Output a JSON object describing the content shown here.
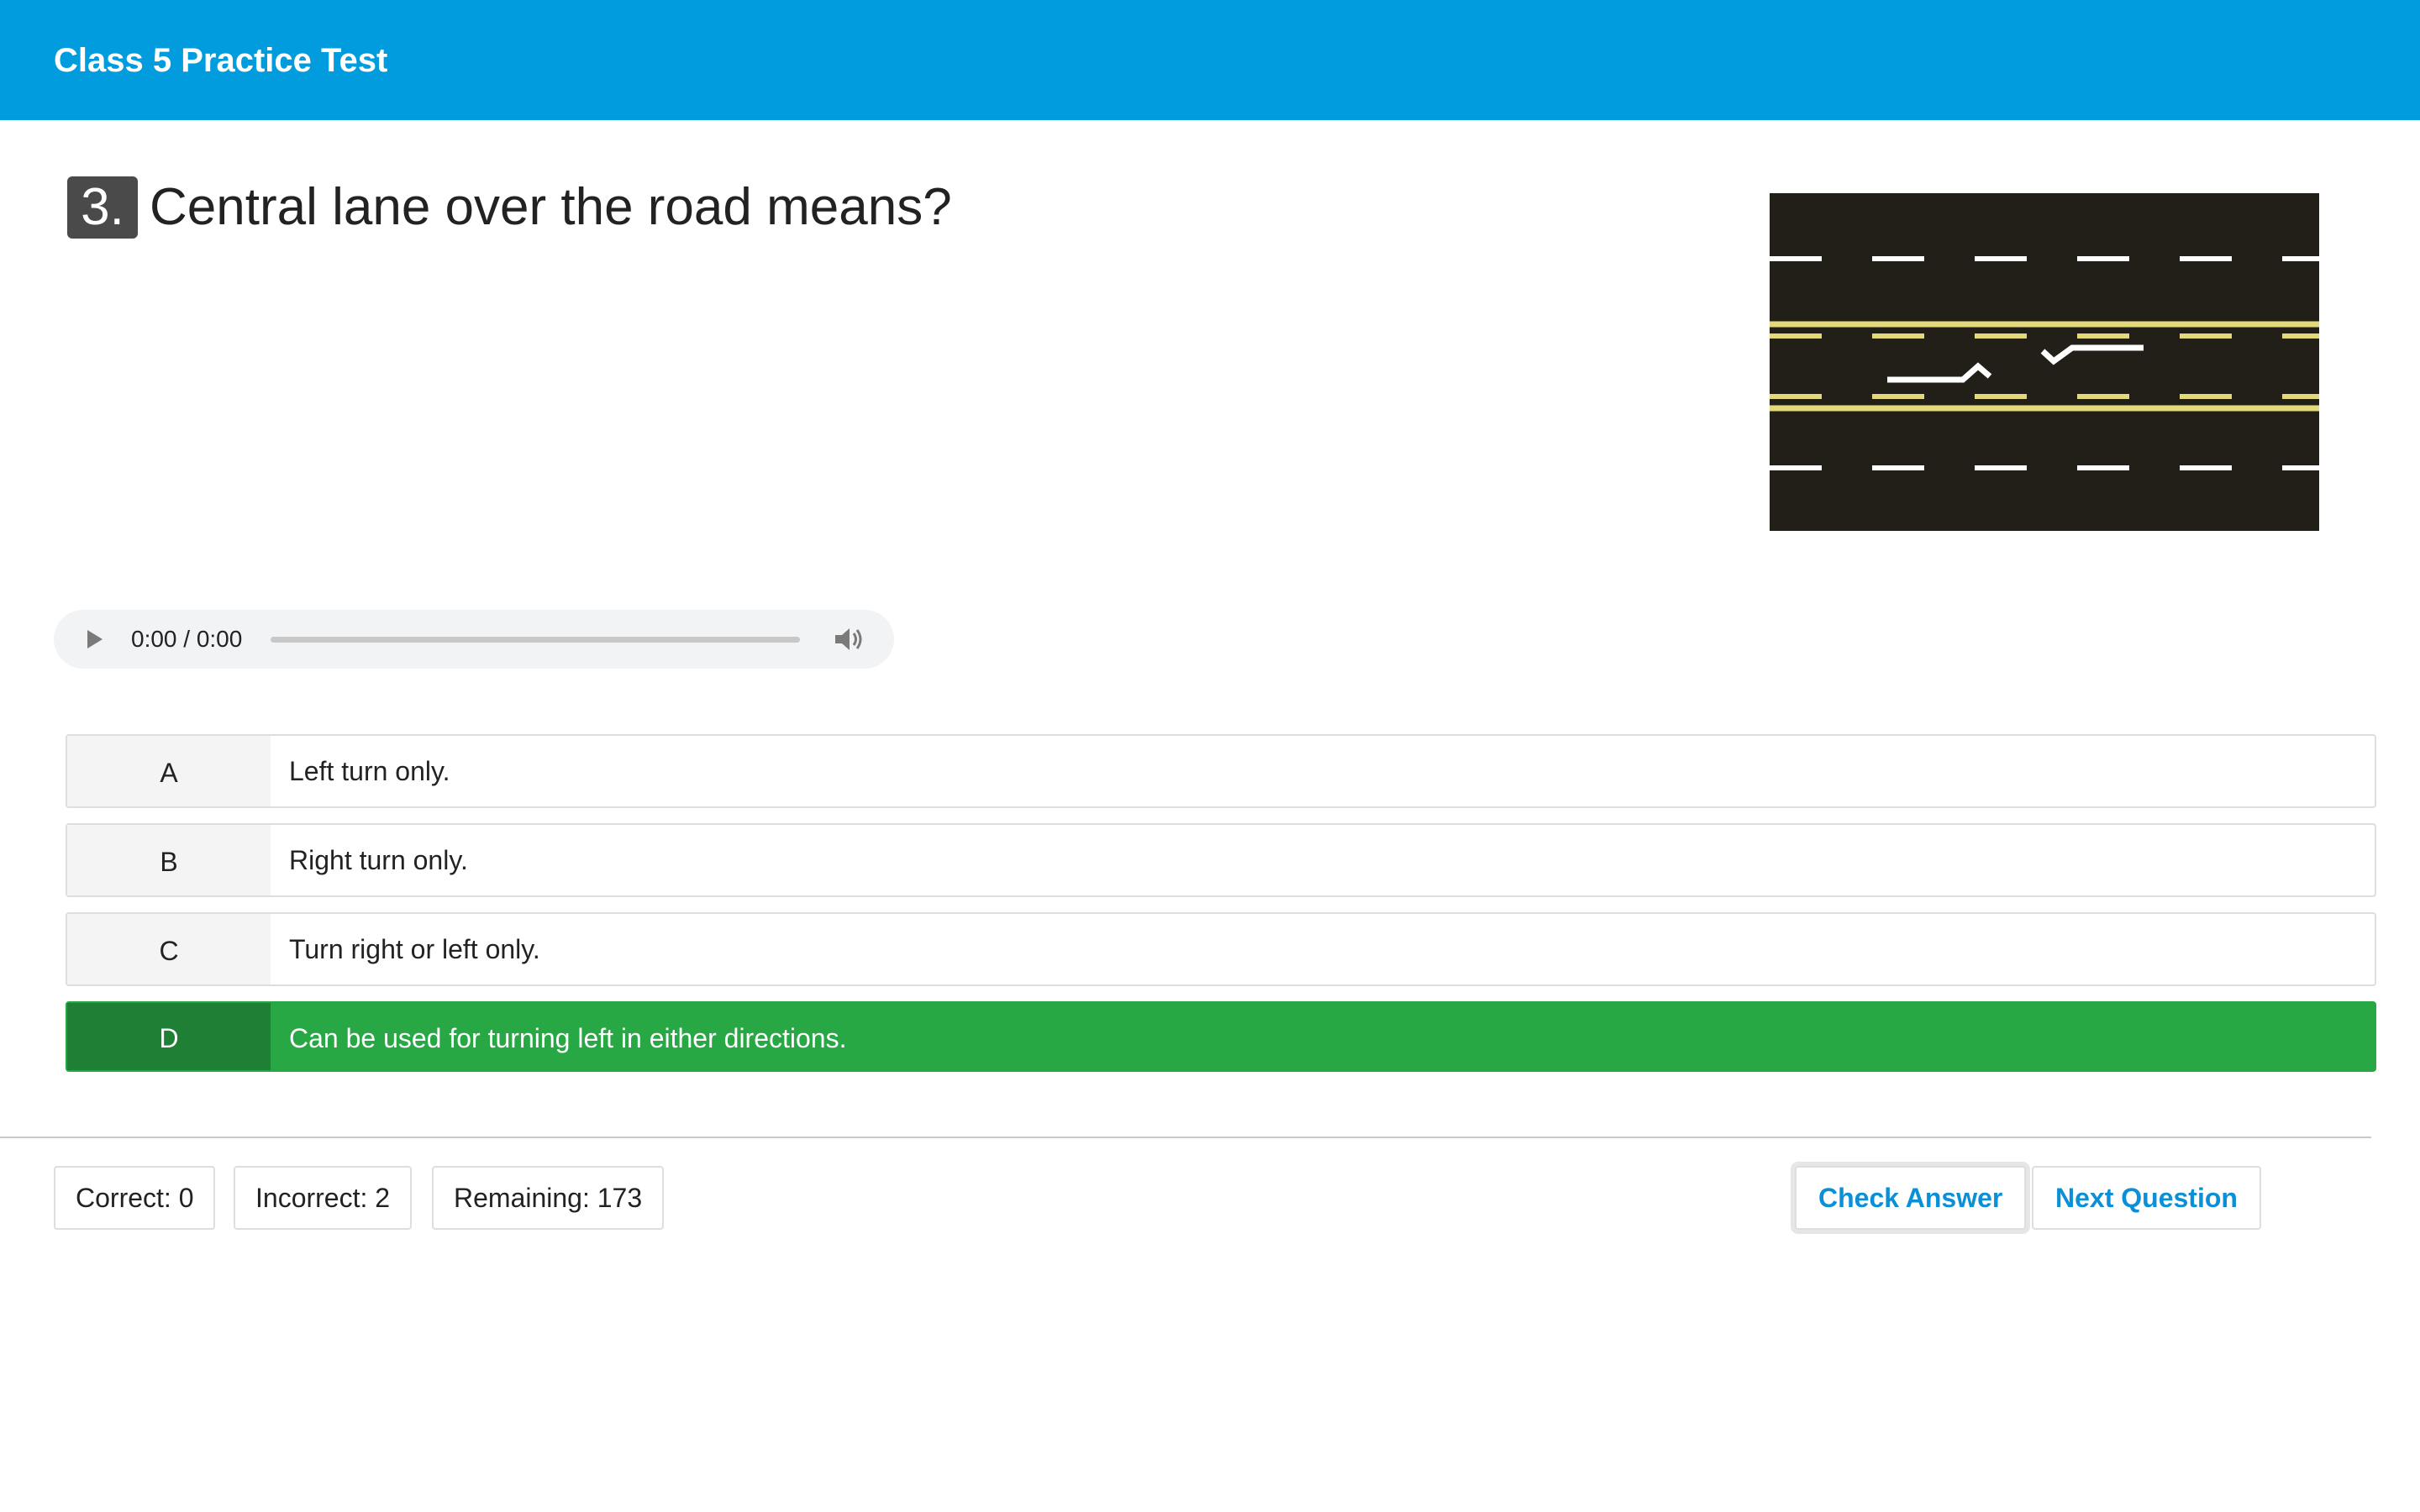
{
  "header": {
    "title": "Class 5 Practice Test"
  },
  "question": {
    "number": "3.",
    "text": "Central lane over the road means?"
  },
  "image": {
    "name": "road-markings-image"
  },
  "audio": {
    "time": "0:00 / 0:00"
  },
  "options": [
    {
      "letter": "A",
      "text": "Left turn only."
    },
    {
      "letter": "B",
      "text": "Right turn only."
    },
    {
      "letter": "C",
      "text": "Turn right or left only."
    },
    {
      "letter": "D",
      "text": "Can be used for turning left in either directions."
    }
  ],
  "stats": {
    "correct": "Correct: 0",
    "incorrect": "Incorrect: 2",
    "remaining": "Remaining: 173"
  },
  "buttons": {
    "check": "Check Answer",
    "next": "Next Question"
  },
  "colors": {
    "header": "#009cde",
    "selected": "#28a745",
    "selected_letter": "#1f7f35",
    "button_text": "#0b8fd6"
  },
  "icons": [
    "play-icon",
    "volume-icon"
  ]
}
